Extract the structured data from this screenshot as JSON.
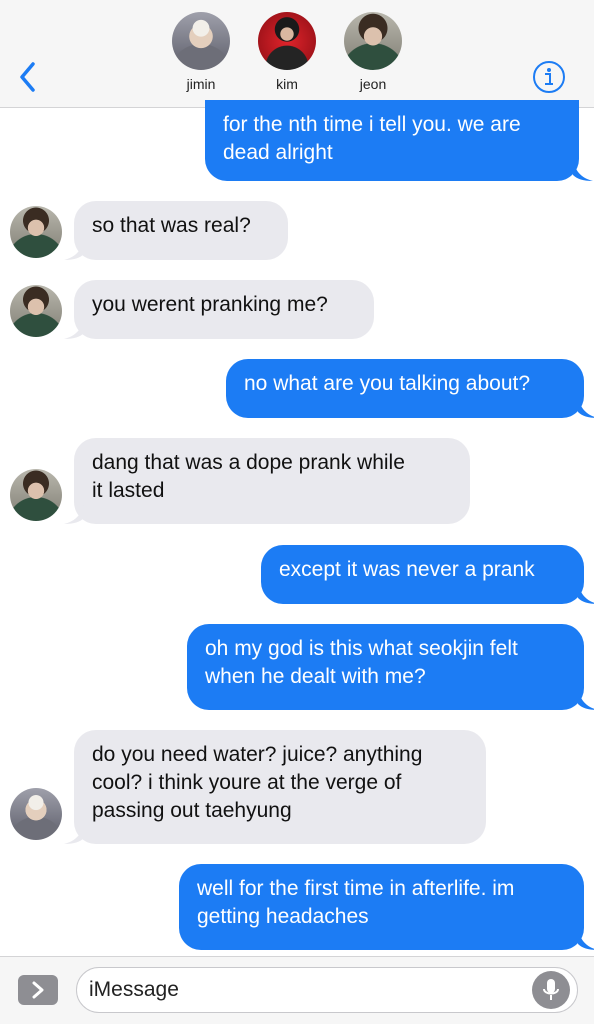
{
  "header": {
    "participants": [
      {
        "name": "jimin"
      },
      {
        "name": "kim"
      },
      {
        "name": "jeon"
      }
    ]
  },
  "messages": [
    {
      "direction": "out",
      "lines": [
        "for the nth time i tell you. we are",
        "dead alright"
      ]
    },
    {
      "direction": "in",
      "sender": "jeon",
      "lines": [
        "so that was real?"
      ]
    },
    {
      "direction": "in",
      "sender": "jeon",
      "lines": [
        "you werent pranking me?"
      ]
    },
    {
      "direction": "out",
      "lines": [
        "no what are you talking about?"
      ]
    },
    {
      "direction": "in",
      "sender": "jeon",
      "lines": [
        "dang that was a dope prank while",
        "it lasted"
      ]
    },
    {
      "direction": "out",
      "lines": [
        "except it was never a prank"
      ]
    },
    {
      "direction": "out",
      "lines": [
        "oh my god is this what seokjin felt",
        "when he dealt with me?"
      ]
    },
    {
      "direction": "in",
      "sender": "jimin",
      "lines": [
        "do you need water? juice? anything",
        "cool? i think youre at the verge of",
        "passing out taehyung"
      ]
    },
    {
      "direction": "out",
      "lines": [
        "well for the first time in afterlife. im",
        "getting headaches"
      ]
    }
  ],
  "composer": {
    "placeholder": "iMessage"
  },
  "colors": {
    "outgoing_bubble": "#1c7cf4",
    "incoming_bubble": "#e9e9ee",
    "accent": "#1c7cf4"
  },
  "icons": [
    "back-chevron-icon",
    "info-icon",
    "app-store-chevron-icon",
    "microphone-icon"
  ]
}
